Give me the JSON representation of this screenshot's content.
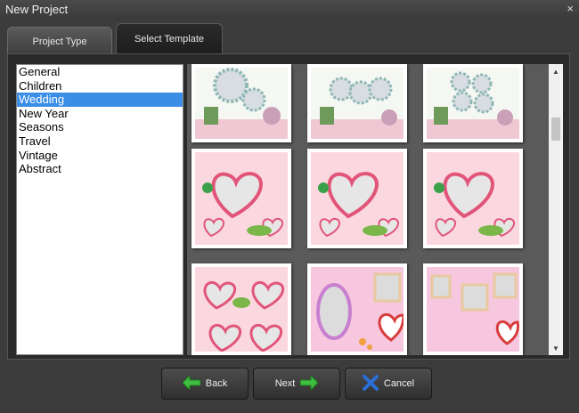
{
  "window": {
    "title": "New Project",
    "close_glyph": "×"
  },
  "tabs": [
    {
      "label": "Project Type",
      "active": false
    },
    {
      "label": "Select Template",
      "active": true
    }
  ],
  "categories": [
    {
      "label": "General"
    },
    {
      "label": "Children"
    },
    {
      "label": "Wedding",
      "selected": true
    },
    {
      "label": "New Year"
    },
    {
      "label": "Seasons"
    },
    {
      "label": "Travel"
    },
    {
      "label": "Vintage"
    },
    {
      "label": "Abstract"
    }
  ],
  "templates": [
    {
      "kind": "frames-garden"
    },
    {
      "kind": "frames-garden"
    },
    {
      "kind": "frames-garden"
    },
    {
      "kind": "pink-hearts"
    },
    {
      "kind": "pink-hearts"
    },
    {
      "kind": "pink-hearts"
    },
    {
      "kind": "double-heart"
    },
    {
      "kind": "oval-frame"
    },
    {
      "kind": "photo-hearts"
    }
  ],
  "buttons": {
    "back": {
      "label": "Back",
      "icon": "arrow-left-icon"
    },
    "next": {
      "label": "Next",
      "icon": "arrow-right-icon"
    },
    "cancel": {
      "label": "Cancel",
      "icon": "x-icon"
    }
  },
  "colors": {
    "selection": "#3a8ee6",
    "arrow": "#3fbf3f",
    "cancel": "#2a6fd6"
  }
}
